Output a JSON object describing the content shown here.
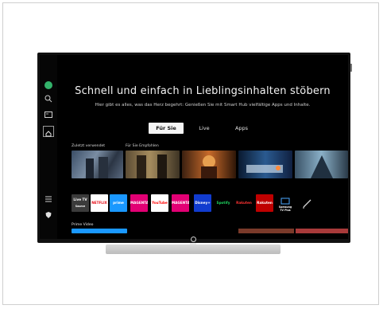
{
  "hero": {
    "title": "Schnell und einfach in Lieblingsinhalten stöbern",
    "subtitle": "Hier gibt es alles, was das Herz begehrt: Genießen Sie mit Smart Hub vielfältige Apps und Inhalte."
  },
  "tabs": [
    {
      "label": "Für Sie",
      "active": true
    },
    {
      "label": "Live",
      "active": false
    },
    {
      "label": "Apps",
      "active": false
    }
  ],
  "sections": {
    "recent": "Zuletzt verwendet",
    "recommended": "Für Sie Empfohlen",
    "prime": "Prime Video"
  },
  "apps": [
    {
      "name": "Live TV",
      "sub": "Source",
      "color": "#3b3b3b"
    },
    {
      "name": "NETFLIX",
      "color": "#ffffff",
      "text": "#e50914"
    },
    {
      "name": "prime video",
      "color": "#1a98ff"
    },
    {
      "name": "MAGENTA TV",
      "color": "#e20074"
    },
    {
      "name": "YouTube",
      "color": "#ffffff",
      "text": "#ff0000"
    },
    {
      "name": "MAGENTA SPORT",
      "color": "#e20074"
    },
    {
      "name": "Disney+",
      "color": "#113ccf"
    },
    {
      "name": "Spotify",
      "color": "#000000",
      "text": "#1ed760"
    },
    {
      "name": "Rakuten TV",
      "color": "#000000",
      "text": "#ff3333"
    },
    {
      "name": "Rakuten TV",
      "color": "#bf0000"
    },
    {
      "name": "Samsung TV Plus",
      "color": "#000000"
    }
  ],
  "icons": {
    "profile": "avatar-icon",
    "search": "search-icon",
    "source": "source-icon",
    "home": "home-icon",
    "menu": "menu-icon",
    "privacy": "shield-icon",
    "edit": "pencil-icon",
    "tv_logo": "tv-logo-icon"
  }
}
